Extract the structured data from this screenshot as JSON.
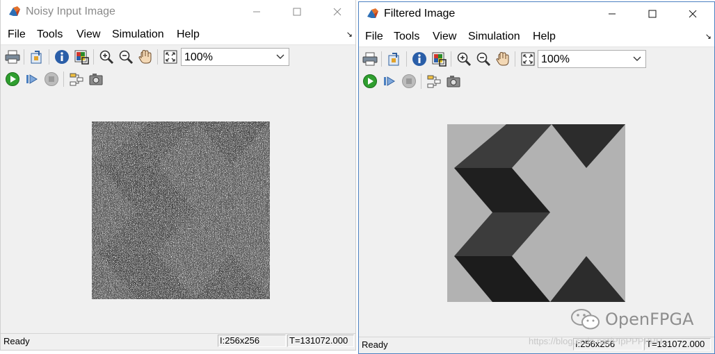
{
  "left_window": {
    "title": "Noisy Input Image",
    "menu": [
      "File",
      "Tools",
      "View",
      "Simulation",
      "Help"
    ],
    "zoom_value": "100%",
    "status": {
      "ready": "Ready",
      "size": "I:256x256",
      "time": "T=131072.000"
    }
  },
  "right_window": {
    "title": "Filtered Image",
    "menu": [
      "File",
      "Tools",
      "View",
      "Simulation",
      "Help"
    ],
    "zoom_value": "100%",
    "status": {
      "ready": "Ready",
      "size": "I:256x256",
      "time": "T=131072.000"
    }
  },
  "toolbar_icons": [
    "print-icon",
    "parameters-icon",
    "info-icon",
    "pixel-region-icon",
    "zoom-in-icon",
    "zoom-out-icon",
    "pan-hand-icon",
    "fit-to-window-icon",
    "zoom-dropdown"
  ],
  "simulation_icons": [
    "run-icon",
    "step-forward-icon",
    "stop-icon",
    "highlight-model-icon",
    "snapshot-icon"
  ],
  "watermark": {
    "text": "OpenFPGA",
    "url": "https://blog.csdn.net/PIpPPPPPH"
  },
  "colors": {
    "image_light": "#b4b4b4",
    "image_dark_1": "#3c3c3c",
    "image_dark_2": "#1e1e1e",
    "accent_border": "#4a7fc0",
    "run_green": "#2f9e2f"
  }
}
